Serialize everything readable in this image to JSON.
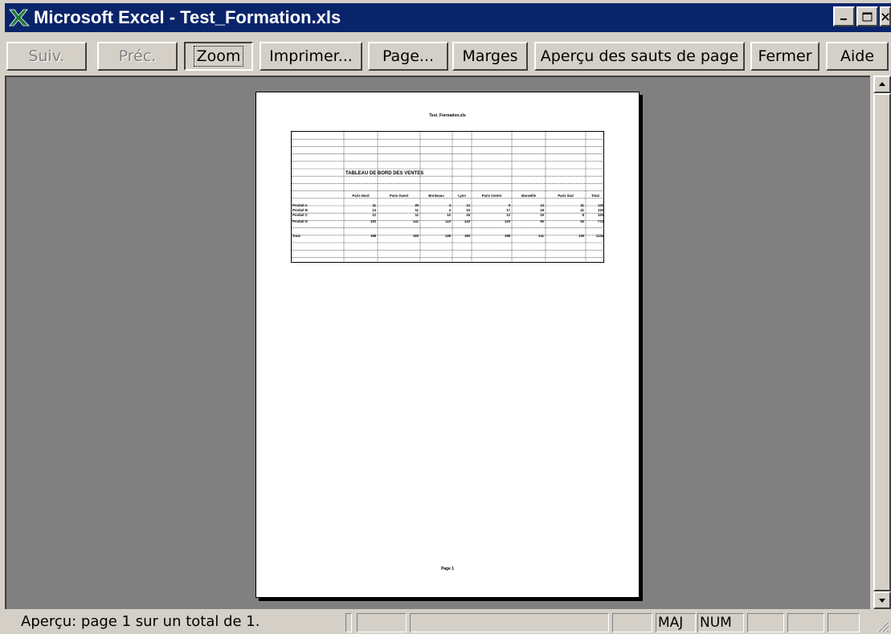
{
  "window": {
    "title": "Microsoft Excel - Test_Formation.xls",
    "icon": "excel-icon",
    "controls": [
      "minimize-icon",
      "maximize-icon",
      "close-icon"
    ]
  },
  "toolbar": {
    "buttons": [
      {
        "label": "Suiv.",
        "state": "disabled"
      },
      {
        "label": "Préc.",
        "state": "disabled"
      },
      {
        "label": "Zoom",
        "state": "pressed"
      },
      {
        "label": "Imprimer...",
        "state": "normal"
      },
      {
        "label": "Page...",
        "state": "normal"
      },
      {
        "label": "Marges",
        "state": "normal"
      },
      {
        "label": "Aperçu des sauts de page",
        "state": "normal"
      },
      {
        "label": "Fermer",
        "state": "normal"
      },
      {
        "label": "Aide",
        "state": "normal"
      }
    ]
  },
  "page": {
    "header": "Test_Formation.xls",
    "footer": "Page 1",
    "sheet": {
      "table_title": "TABLEAU DE BORD DES VENTES",
      "column_headers": [
        "Paris Nord",
        "Paris Ouest",
        "Bordeaux",
        "Lyon",
        "Paris Centre",
        "Marseille",
        "Paris Sud",
        "Total"
      ],
      "rows": [
        {
          "label": "Produit A",
          "values": [
            "11",
            "30",
            "4",
            "12",
            "9",
            "14",
            "31",
            "120"
          ]
        },
        {
          "label": "Produit B",
          "values": [
            "14",
            "11",
            "4",
            "10",
            "17",
            "18",
            "41",
            "120"
          ]
        },
        {
          "label": "Produit C",
          "values": [
            "12",
            "11",
            "10",
            "18",
            "12",
            "19",
            "8",
            "120"
          ]
        },
        {
          "label": "Produit D",
          "values": [
            "120",
            "141",
            "110",
            "143",
            "120",
            "90",
            "50",
            "774"
          ]
        },
        {
          "label": "Total",
          "values": [
            "158",
            "193",
            "128",
            "183",
            "158",
            "141",
            "130",
            "1134"
          ]
        }
      ]
    }
  },
  "statusbar": {
    "text": "Aperçu: page 1 sur un total de 1.",
    "indicators": [
      "MAJ",
      "NUM"
    ]
  },
  "colors": {
    "titlebar": "#0a246a",
    "chrome": "#d4d0c8",
    "preview_bg": "#808080",
    "excel_green": "#1e7b3c"
  }
}
